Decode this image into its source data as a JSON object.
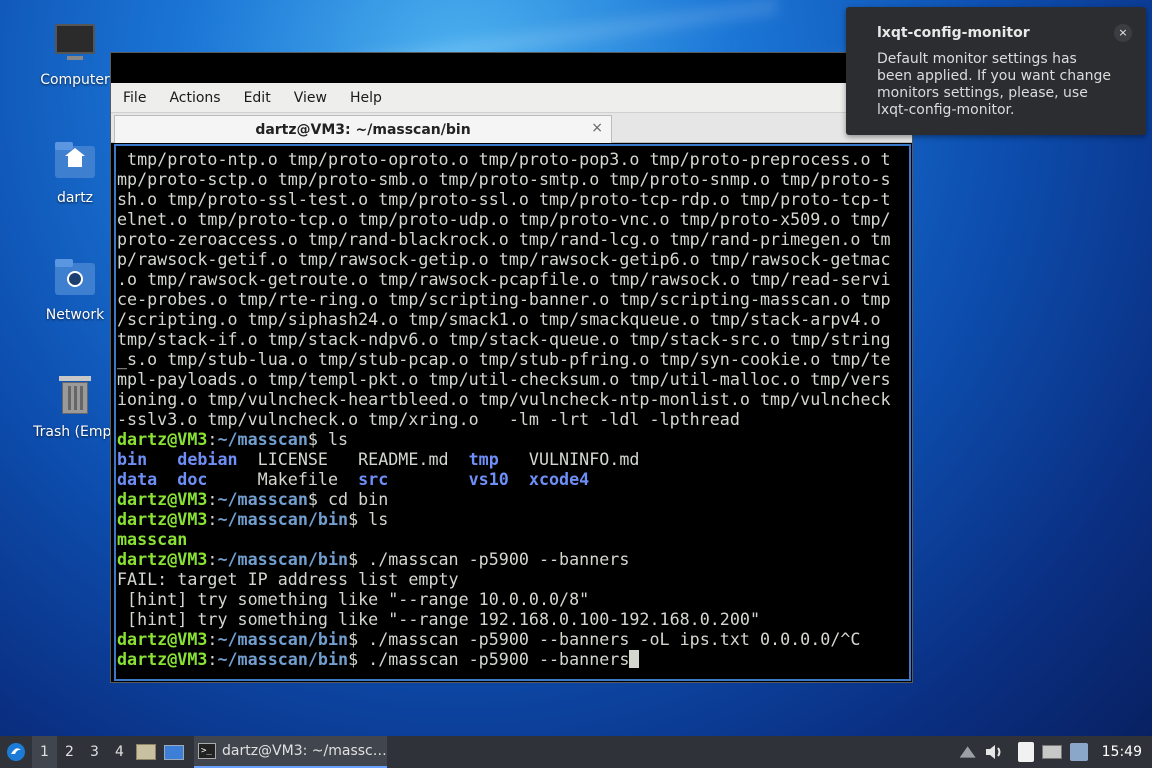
{
  "desktop": {
    "icons": [
      {
        "label": "Computer",
        "icon": "computer-icon"
      },
      {
        "label": "dartz",
        "icon": "home-folder-icon"
      },
      {
        "label": "Network",
        "icon": "network-folder-icon"
      },
      {
        "label": "Trash (Empt",
        "icon": "trash-icon"
      }
    ]
  },
  "terminal": {
    "menu": [
      "File",
      "Actions",
      "Edit",
      "View",
      "Help"
    ],
    "tab_title": "dartz@VM3: ~/masscan/bin",
    "tab_close": "×",
    "output": [
      " tmp/proto-ntp.o tmp/proto-oproto.o tmp/proto-pop3.o tmp/proto-preprocess.o t",
      "mp/proto-sctp.o tmp/proto-smb.o tmp/proto-smtp.o tmp/proto-snmp.o tmp/proto-s",
      "sh.o tmp/proto-ssl-test.o tmp/proto-ssl.o tmp/proto-tcp-rdp.o tmp/proto-tcp-t",
      "elnet.o tmp/proto-tcp.o tmp/proto-udp.o tmp/proto-vnc.o tmp/proto-x509.o tmp/",
      "proto-zeroaccess.o tmp/rand-blackrock.o tmp/rand-lcg.o tmp/rand-primegen.o tm",
      "p/rawsock-getif.o tmp/rawsock-getip.o tmp/rawsock-getip6.o tmp/rawsock-getmac",
      ".o tmp/rawsock-getroute.o tmp/rawsock-pcapfile.o tmp/rawsock.o tmp/read-servi",
      "ce-probes.o tmp/rte-ring.o tmp/scripting-banner.o tmp/scripting-masscan.o tmp",
      "/scripting.o tmp/siphash24.o tmp/smack1.o tmp/smackqueue.o tmp/stack-arpv4.o",
      "tmp/stack-if.o tmp/stack-ndpv6.o tmp/stack-queue.o tmp/stack-src.o tmp/string",
      "_s.o tmp/stub-lua.o tmp/stub-pcap.o tmp/stub-pfring.o tmp/syn-cookie.o tmp/te",
      "mpl-payloads.o tmp/templ-pkt.o tmp/util-checksum.o tmp/util-malloc.o tmp/vers",
      "ioning.o tmp/vulncheck-heartbleed.o tmp/vulncheck-ntp-monlist.o tmp/vulncheck",
      "-sslv3.o tmp/vulncheck.o tmp/xring.o   -lm -lrt -ldl -lpthread"
    ],
    "prompt_user": "dartz@VM3",
    "cwd_masscan": "~/masscan",
    "cwd_bin": "~/masscan/bin",
    "cmd_ls": " ls",
    "ls_row1": {
      "c1": "bin",
      "c2": "debian",
      "c3": "LICENSE",
      "c4": "README.md",
      "c5": "tmp",
      "c6": "VULNINFO.md"
    },
    "ls_row2": {
      "c1": "data",
      "c2": "doc",
      "c3": "Makefile",
      "c4": "src",
      "c5": "vs10",
      "c6": "xcode4"
    },
    "cmd_cd": " cd bin",
    "ls_bin": "masscan",
    "cmd_run1": " ./masscan -p5900 --banners",
    "fail": "FAIL: target IP address list empty",
    "hint1": " [hint] try something like \"--range 10.0.0.0/8\"",
    "hint2": " [hint] try something like \"--range 192.168.0.100-192.168.0.200\"",
    "cmd_run2": " ./masscan -p5900 --banners -oL ips.txt 0.0.0.0/^C",
    "cmd_run3": " ./masscan -p5900 --banners"
  },
  "notification": {
    "title": "lxqt-config-monitor",
    "body": "Default monitor settings has been applied. If you want change monitors settings, please, use lxqt-config-monitor.",
    "close": "×"
  },
  "taskbar": {
    "workspaces": [
      "1",
      "2",
      "3",
      "4"
    ],
    "task_label": "dartz@VM3: ~/massc…",
    "clock": "15:49"
  }
}
